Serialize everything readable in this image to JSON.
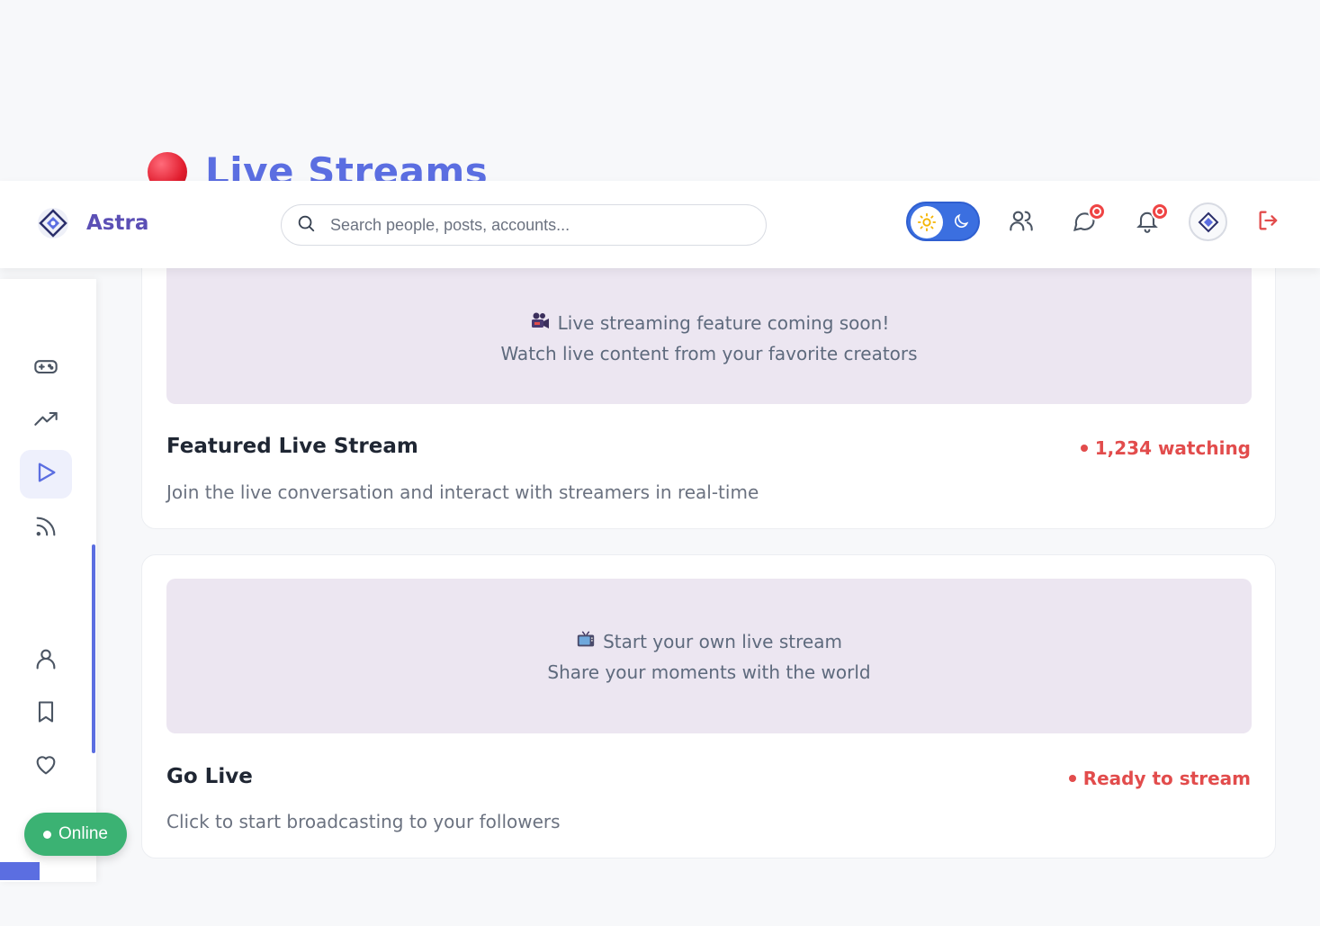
{
  "page": {
    "title": "Live Streams"
  },
  "header": {
    "brand_name": "Astra",
    "search_placeholder": "Search people, posts, accounts...",
    "icons": [
      "users-icon",
      "chat-icon",
      "bell-icon",
      "avatar",
      "logout-icon"
    ],
    "theme": {
      "sun": "sun-icon",
      "moon": "moon-icon",
      "active": "light"
    },
    "accent_color": "#3b6fe0",
    "badge_color": "#ef4444"
  },
  "sidebar": {
    "items": [
      {
        "icon": "gamepad-icon"
      },
      {
        "icon": "trending-icon"
      },
      {
        "icon": "play-icon",
        "active": true
      },
      {
        "icon": "rss-icon"
      },
      {
        "icon": "user-icon"
      },
      {
        "icon": "bookmark-icon"
      },
      {
        "icon": "heart-icon"
      }
    ],
    "status_label": "Online",
    "status_color": "#3bb273"
  },
  "cards": [
    {
      "preview_line1": "Live streaming feature coming soon!",
      "preview_line2": "Watch live content from your favorite creators",
      "preview_icon": "video-camera-icon",
      "title": "Featured Live Stream",
      "status": "1,234 watching",
      "description": "Join the live conversation and interact with streamers in real-time"
    },
    {
      "preview_line1": "Start your own live stream",
      "preview_line2": "Share your moments with the world",
      "preview_icon": "tv-icon",
      "title": "Go Live",
      "status": "Ready to stream",
      "description": "Click to start broadcasting to your followers"
    }
  ],
  "colors": {
    "brand": "#5b4fb5",
    "title": "#5b6ee1",
    "status_red": "#e24c4c",
    "preview_bg": "#ece6f1"
  }
}
